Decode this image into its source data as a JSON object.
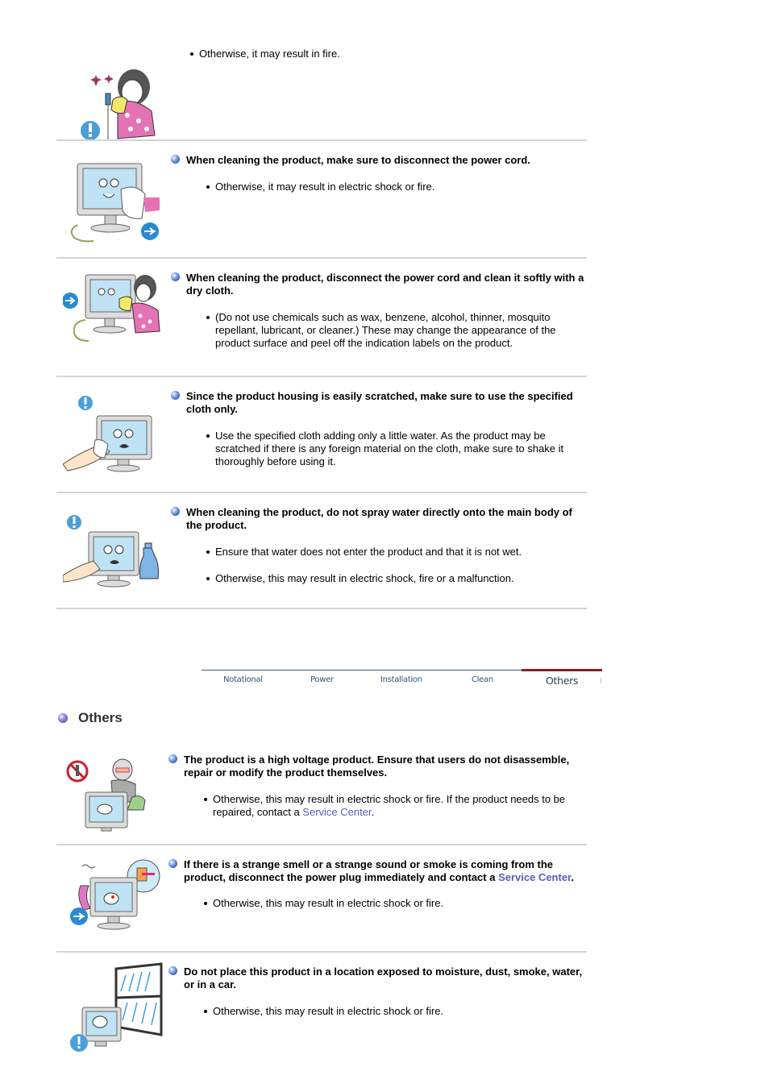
{
  "cleaning_items": [
    {
      "illustration": "woman-cleaning-plug-illustration",
      "heading": "",
      "bullets": [
        "Otherwise, it may result in fire."
      ]
    },
    {
      "illustration": "monitor-cleaning-unplugged-illustration",
      "heading": "When cleaning the product, make sure to disconnect the power cord.",
      "bullets": [
        "Otherwise, it may result in electric shock or fire."
      ]
    },
    {
      "illustration": "woman-wiping-monitor-illustration",
      "heading": "When cleaning the product, disconnect the power cord and clean it softly with a dry cloth.",
      "bullets": [
        "(Do not use chemicals such as wax, benzene, alcohol, thinner, mosquito repellant, lubricant, or cleaner.) These may change the appearance of the product surface and peel off the indication labels on the product."
      ]
    },
    {
      "illustration": "hand-wiping-scared-monitor-illustration",
      "heading": "Since the product housing is easily scratched, make sure to use the specified cloth only.",
      "bullets": [
        "Use the specified cloth adding only a little water. As the product may be scratched if there is any foreign material on the cloth, make sure to shake it thoroughly before using it."
      ]
    },
    {
      "illustration": "spray-bottle-monitor-illustration",
      "heading": "When cleaning the product, do not spray water directly onto the main body of the product.",
      "bullets": [
        "Ensure that water does not enter the product and that it is not wet.",
        "Otherwise, this may result in electric shock, fire or a malfunction."
      ]
    }
  ],
  "nav": {
    "tabs": [
      "Notational",
      "Power",
      "Installation",
      "Clean",
      "Others"
    ],
    "active": "Others",
    "active_color": "#8a1d23"
  },
  "others": {
    "title": "Others",
    "items": [
      {
        "heading": "The product is a high voltage product. Ensure that users do not disassemble, repair or modify the product themselves.",
        "bullet_pre": "Otherwise, this may result in electric shock or fire. If the product needs to be repaired, contact a ",
        "bullet_link": "Service Center",
        "bullet_post": "."
      },
      {
        "heading_pre": "If there is a strange smell or a strange sound or smoke is coming from the product, disconnect the power plug immediately and contact a ",
        "heading_link": "Service Center",
        "heading_post": ".",
        "bullet": "Otherwise, this may result in electric shock or fire."
      },
      {
        "heading": "Do not place this product in a location exposed to moisture, dust, smoke, water, or in a car.",
        "bullet": "Otherwise, this may result in electric shock or fire."
      }
    ]
  },
  "colors": {
    "link": "#5b5bc2",
    "divider": "#d3d3d3",
    "nav_text": "#2f5577"
  }
}
